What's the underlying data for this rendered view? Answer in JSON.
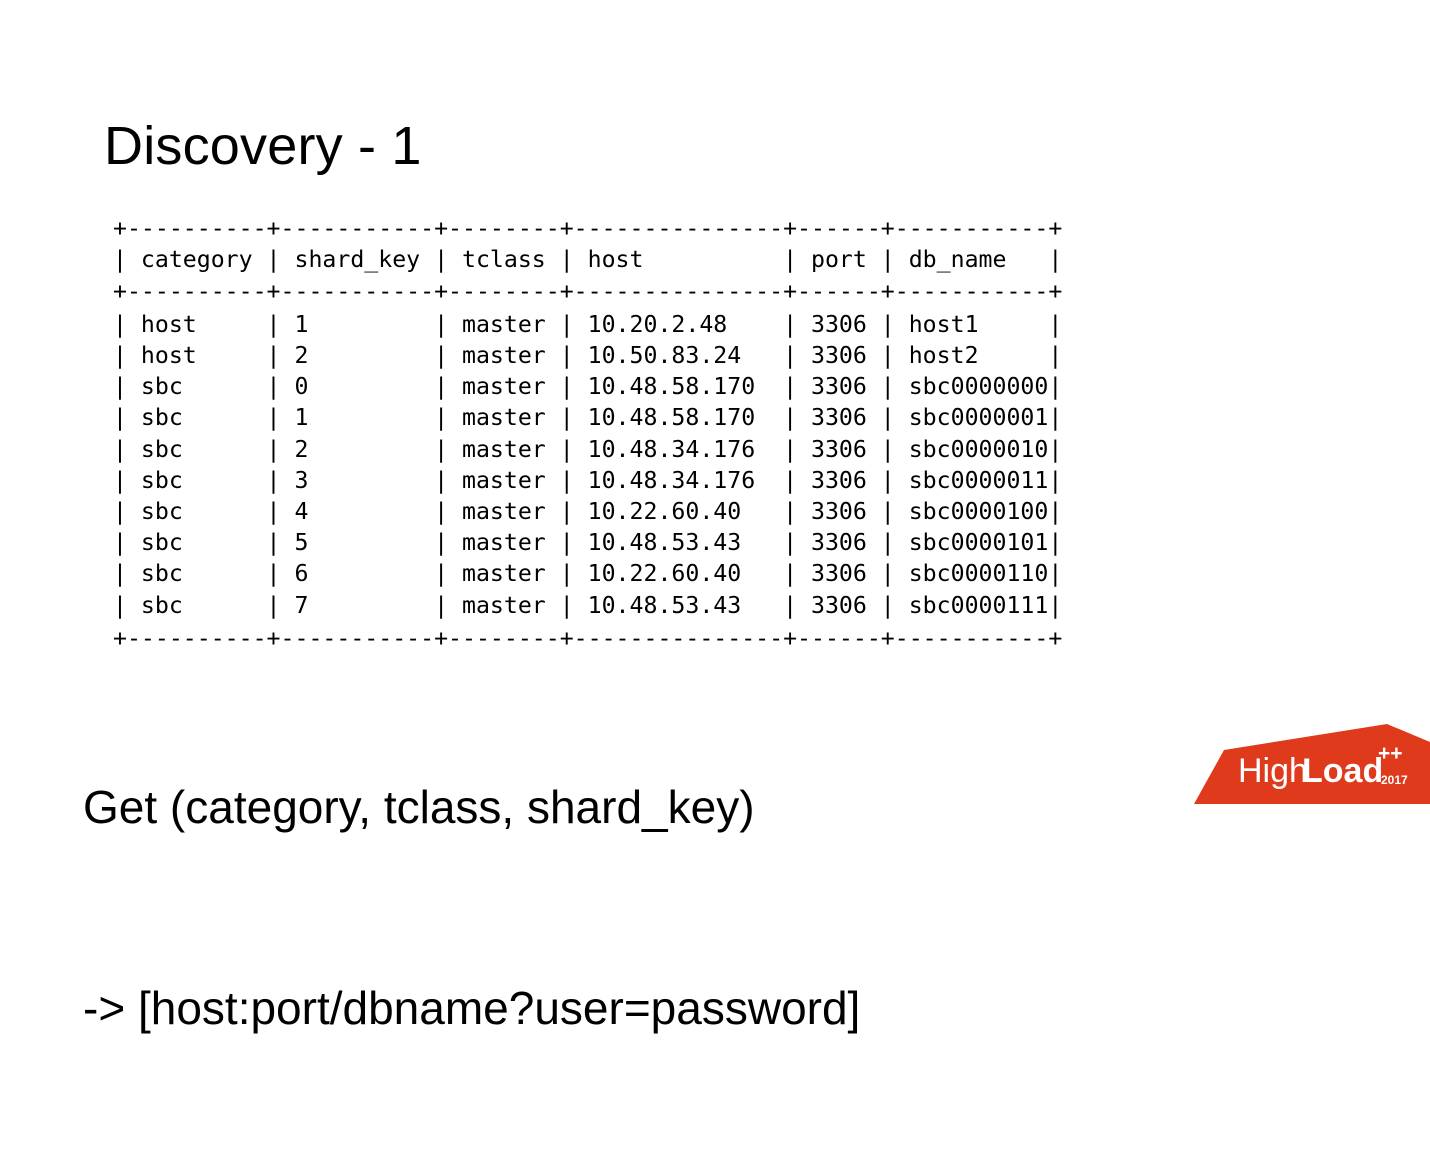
{
  "slide": {
    "title": "Discovery - 1",
    "background_color": "#ffffff",
    "text_color": "#000000"
  },
  "table": {
    "type": "ascii-art-mysql-result",
    "columns": [
      {
        "name": "category",
        "width": 10
      },
      {
        "name": "shard_key",
        "width": 11
      },
      {
        "name": "tclass",
        "width": 8
      },
      {
        "name": "host",
        "width": 15
      },
      {
        "name": "port",
        "width": 6
      },
      {
        "name": "db_name",
        "width": 11
      }
    ],
    "headers": [
      "category",
      "shard_key",
      "tclass",
      "host",
      "port",
      "db_name"
    ],
    "rows": [
      [
        "host",
        "1",
        "master",
        "10.20.2.48",
        "3306",
        "host1"
      ],
      [
        "host",
        "2",
        "master",
        "10.50.83.24",
        "3306",
        "host2"
      ],
      [
        "sbc",
        "0",
        "master",
        "10.48.58.170",
        "3306",
        "sbc0000000"
      ],
      [
        "sbc",
        "1",
        "master",
        "10.48.58.170",
        "3306",
        "sbc0000001"
      ],
      [
        "sbc",
        "2",
        "master",
        "10.48.34.176",
        "3306",
        "sbc0000010"
      ],
      [
        "sbc",
        "3",
        "master",
        "10.48.34.176",
        "3306",
        "sbc0000011"
      ],
      [
        "sbc",
        "4",
        "master",
        "10.22.60.40",
        "3306",
        "sbc0000100"
      ],
      [
        "sbc",
        "5",
        "master",
        "10.48.53.43",
        "3306",
        "sbc0000101"
      ],
      [
        "sbc",
        "6",
        "master",
        "10.22.60.40",
        "3306",
        "sbc0000110"
      ],
      [
        "sbc",
        "7",
        "master",
        "10.48.53.43",
        "3306",
        "sbc0000111"
      ]
    ]
  },
  "caption": {
    "line1": "Get (category, tclass, shard_key)",
    "line2": "-> [host:port/dbname?user=password]"
  },
  "logo": {
    "text_high": "High",
    "text_load": "Load",
    "plus_plus": "++",
    "year": "2017",
    "brand_color": "#E03A1C",
    "text_color": "#ffffff"
  }
}
